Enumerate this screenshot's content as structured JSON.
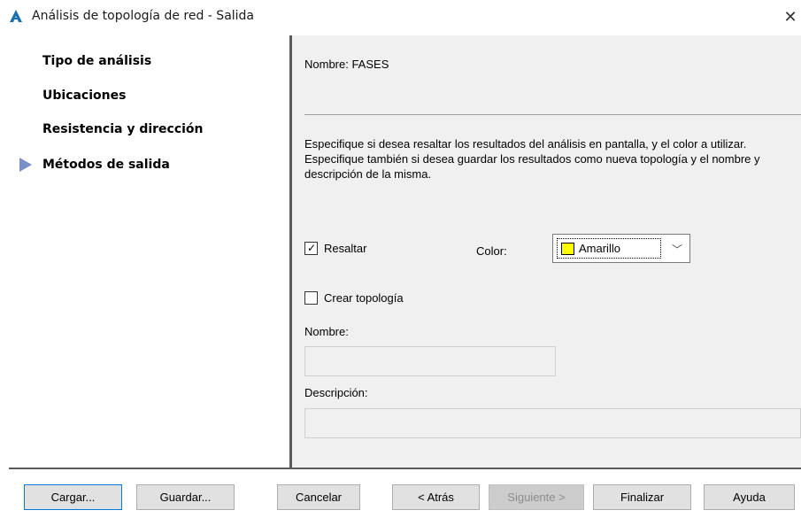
{
  "window": {
    "title": "Análisis de topología de red - Salida",
    "close_glyph": "✕",
    "app_icon": "autocad-a-icon",
    "accent_color": "#0078d7"
  },
  "steps": [
    {
      "label": "Tipo de análisis",
      "current": false
    },
    {
      "label": "Ubicaciones",
      "current": false
    },
    {
      "label": "Resistencia y dirección",
      "current": false
    },
    {
      "label": "Métodos de salida",
      "current": true
    }
  ],
  "content": {
    "name_line": "Nombre: FASES",
    "description": "Especifique si desea resaltar los resultados del análisis en pantalla, y el color a utilizar. Especifique también si desea guardar los resultados como nueva topología y el nombre y descripción de la misma.",
    "highlight": {
      "label": "Resaltar",
      "checked": true
    },
    "color": {
      "label": "Color:",
      "value": "Amarillo",
      "swatch": "#ffff00"
    },
    "create_topology": {
      "label": "Crear topología",
      "checked": false
    },
    "name_field": {
      "label": "Nombre:",
      "value": ""
    },
    "description_field": {
      "label": "Descripción:",
      "value": ""
    }
  },
  "buttons": {
    "load": "Cargar...",
    "save": "Guardar...",
    "cancel": "Cancelar",
    "back": "< Atrás",
    "next": "Siguiente >",
    "finish": "Finalizar",
    "help": "Ayuda"
  }
}
